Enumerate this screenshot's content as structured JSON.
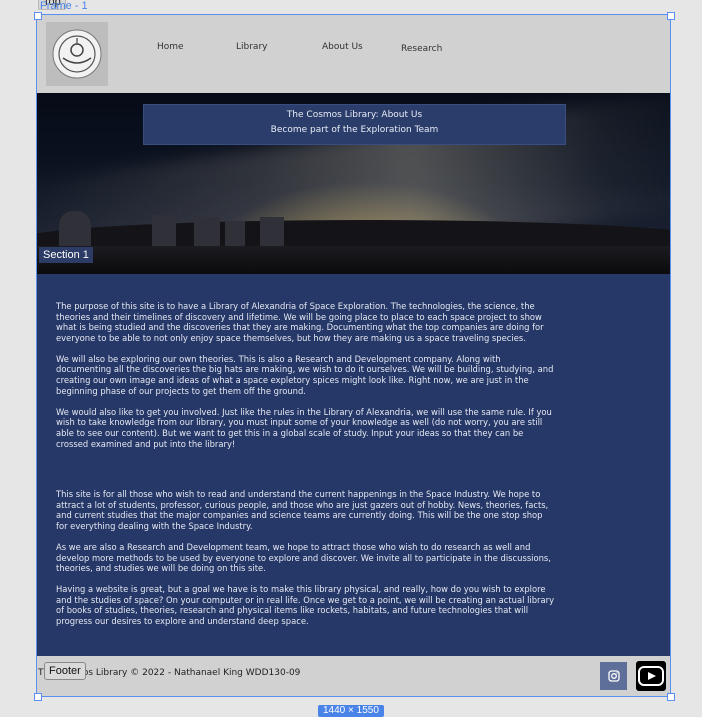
{
  "editor": {
    "top_tag": "Top",
    "frame_label": "Frame - 1",
    "size_label": "1440 × 1550"
  },
  "header": {
    "logo": "logo-icon",
    "nav": [
      {
        "label": "Home"
      },
      {
        "label": "Library"
      },
      {
        "label": "About Us"
      },
      {
        "label": "Research"
      }
    ]
  },
  "hero": {
    "banner_line1": "The Cosmos Library: About Us",
    "banner_line2": "Become part of the Exploration Team",
    "section_label": "Section 1"
  },
  "content": {
    "paragraphs": [
      "The purpose of this site is to have a Library of Alexandria of Space Exploration. The technologies, the science, the theories and their timelines of discovery and lifetime. We will be going place to place to each space project to show what is being studied and the discoveries that they are making. Documenting what the top companies are doing for everyone to be able to not only enjoy space themselves, but how they are making us a space traveling species.",
      "We will also be exploring our own theories. This is also a Research and Development company. Along with documenting all the discoveries the big hats are making, we wish to do it ourselves. We will be building, studying, and creating our own image and ideas of what a space expletory spices might look like. Right now, we are just in the beginning phase of our projects to get them off the ground.",
      "We would also like to get you involved. Just like the rules in the Library of Alexandria, we will use the same rule. If you wish to take knowledge from our library, you must input some of your knowledge as well (do not worry, you are still able to see our content). But we want to get this in a global scale of study. Input your ideas so that they can be crossed examined and put into the library!",
      "This site is for all those who wish to read and understand the current happenings in the Space Industry. We hope to attract a lot of students, professor, curious people, and those who are just gazers out of hobby. News, theories, facts, and current studies that the major companies and science teams are currently doing. This will be the one stop shop for everything dealing with the Space Industry.",
      "As we are also a Research and Development team, we hope to attract those who wish to do research as well and develop more methods to be used by everyone to explore and discover. We invite all to participate in the discussions, theories, and studies we will be doing on this site.",
      "Having a website is great, but a goal we have is to make this library physical, and really, how do you wish to explore and the studies of space? On your computer or in real life. Once we get to a point, we will be creating an actual library of books of studies, theories, research and physical items like rockets, habitats, and future technologies that will progress our desires to explore and understand deep space."
    ]
  },
  "footer": {
    "copyright": "The Cosmos Library © 2022 - Nathanael King WDD130-09",
    "tag_label": "Footer",
    "icons": [
      "instagram-icon",
      "youtube-icon"
    ]
  }
}
